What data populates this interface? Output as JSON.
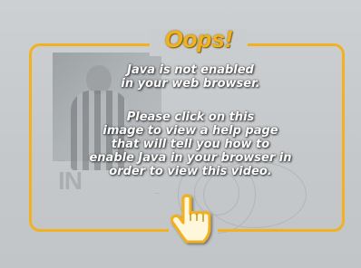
{
  "dialog": {
    "title": "Oops!",
    "message_1": "Java is not enabled\nin your web browser.",
    "message_2": "Please click on this\nimage to view a help page\nthat will tell you how to\nenable Java in your browser in\norder to view this video."
  },
  "background": {
    "logo_text": "IN"
  },
  "colors": {
    "accent": "#f2b11e",
    "background": "#c9ccce",
    "text": "#ffffff"
  },
  "icons": {
    "cursor": "pointing-hand-icon"
  }
}
